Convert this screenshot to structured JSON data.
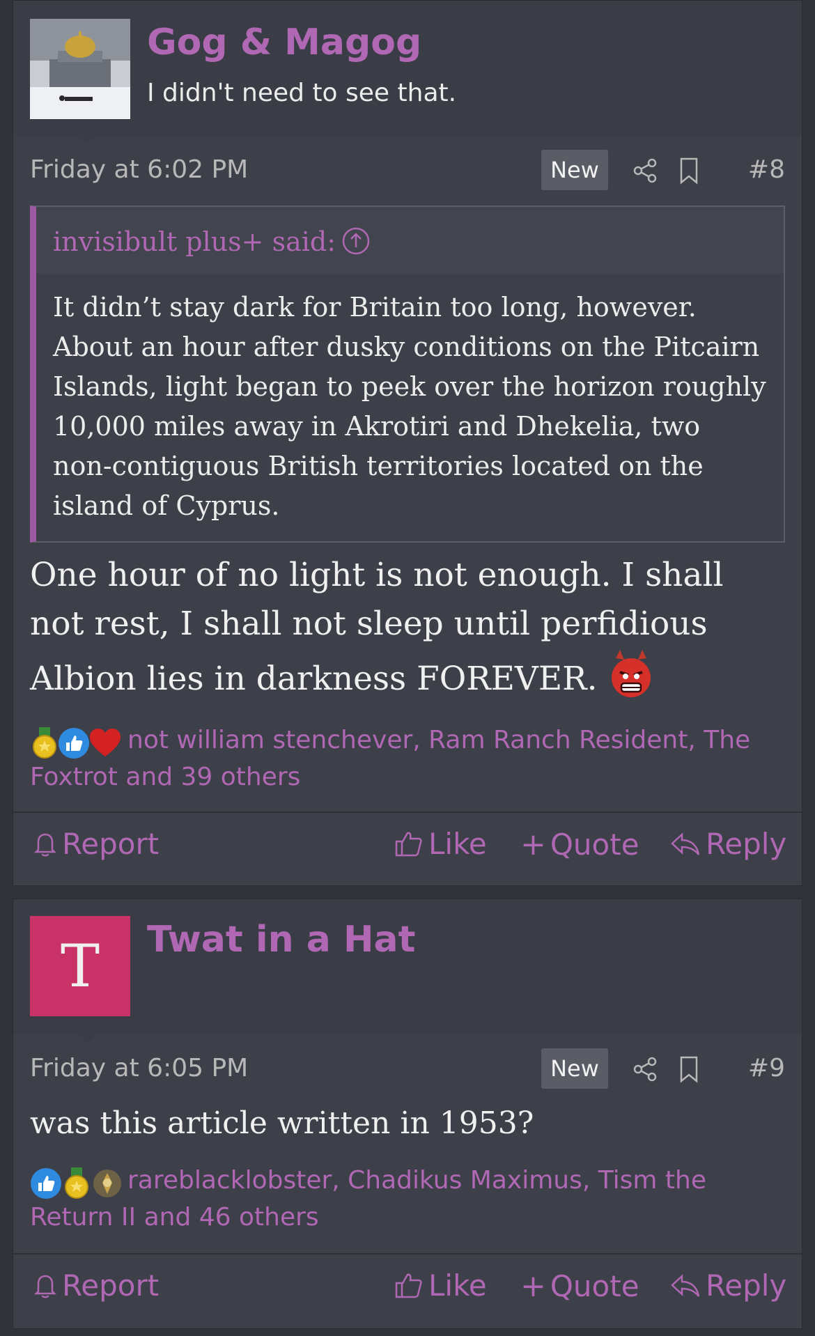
{
  "posts": [
    {
      "username": "Gog & Magog",
      "user_title": "I didn't need to see that.",
      "avatar": "dome-in-snow-photo",
      "timestamp": "Friday at 6:02 PM",
      "badge": "New",
      "post_number": "#8",
      "quote": {
        "attribution": "invisibult plus+ said:",
        "text": "It didn’t stay dark for Britain too long, however. About an hour after dusky conditions on the Pitcairn Islands, light began to peek over the horizon roughly 10,000 miles away in Akrotiri and Dhekelia, two non-contiguous British territories located on the island of Cyprus."
      },
      "body": "One hour of no light is not enough. I shall not rest, I shall not sleep until perfidious Albion lies in darkness FOREVER.",
      "body_emoji": "angry-devil-emoji",
      "reactions_text": "not william stenchever, Ram Ranch Resident, The Foxtrot and 39 others",
      "reaction_icons": [
        "medal-icon",
        "thumbs-up-icon",
        "heart-icon"
      ],
      "actions": {
        "report": "Report",
        "like": "Like",
        "quote": "Quote",
        "reply": "Reply"
      }
    },
    {
      "username": "Twat in a Hat",
      "avatar_letter": "T",
      "avatar_color": "#c83267",
      "timestamp": "Friday at 6:05 PM",
      "badge": "New",
      "post_number": "#9",
      "body": "was this article written in 1953?",
      "reactions_text": "rareblacklobster, Chadikus Maximus, Tism the Return II and 46 others",
      "reaction_icons": [
        "thumbs-up-icon",
        "medal-icon",
        "emblem-icon"
      ],
      "actions": {
        "report": "Report",
        "like": "Like",
        "quote": "Quote",
        "reply": "Reply"
      }
    }
  ],
  "colors": {
    "accent": "#b067b4",
    "background": "#30333a",
    "post_bg": "#3d4049"
  }
}
